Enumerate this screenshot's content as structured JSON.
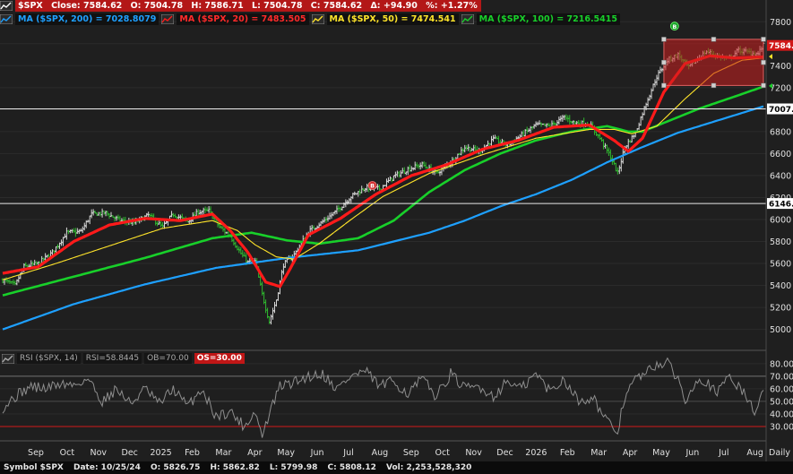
{
  "header": {
    "quote": {
      "symbol": "$SPX",
      "close": "Close: 7584.62",
      "open": "O: 7504.78",
      "high": "H: 7586.71",
      "low": "L: 7504.78",
      "close2": "C: 7584.62",
      "change": "Δ: +94.90",
      "pct": "%: +1.27%"
    },
    "ma200": "MA ($SPX, 200) = 7028.8079",
    "ma20": "MA ($SPX, 20) = 7483.505",
    "ma50": "MA ($SPX, 50) = 7474.541",
    "ma100": "MA ($SPX, 100) = 7216.5415"
  },
  "rsi_header": {
    "name": "RSI ($SPX, 14)",
    "value": "RSI=58.8445",
    "ob": "OB=70.00",
    "os": "OS=30.00"
  },
  "status_bar": {
    "symbol": "Symbol $SPX",
    "date": "Date: 10/25/24",
    "open": "O: 5826.75",
    "high": "H: 5862.82",
    "low": "L: 5799.98",
    "close": "C: 5808.12",
    "vol": "Vol: 2,253,528,320"
  },
  "colors": {
    "ma200": "#1ea0ff",
    "ma20": "#ff1a1a",
    "ma50": "#ffe42a",
    "ma100": "#18d02a",
    "price": "#dcdcdc",
    "rsi": "#8e8e8e",
    "ob": "#6f6f6f",
    "os": "#d01818",
    "box": "#cc1f1f"
  },
  "chart_data": [
    {
      "type": "line",
      "title": "",
      "x_ticks": [
        "Sep",
        "Oct",
        "Nov",
        "Dec",
        "2025",
        "Feb",
        "Mar",
        "Apr",
        "May",
        "Jun",
        "Jul",
        "Aug",
        "Sep",
        "Oct",
        "Nov",
        "Dec",
        "2026",
        "Feb",
        "Mar",
        "Apr",
        "May",
        "Jun",
        "Jul",
        "Aug"
      ],
      "period": "Daily",
      "y_ticks": [
        5000,
        5200,
        5400,
        5600,
        5800,
        6000,
        6200,
        6400,
        6600,
        6800,
        7000,
        7200,
        7400,
        7600,
        7800
      ],
      "ylim": [
        4850,
        7900
      ],
      "price_anchors": [
        [
          0,
          5450
        ],
        [
          7,
          5400
        ],
        [
          12,
          5570
        ],
        [
          20,
          5600
        ],
        [
          28,
          5700
        ],
        [
          36,
          5880
        ],
        [
          44,
          5890
        ],
        [
          50,
          6050
        ],
        [
          58,
          6060
        ],
        [
          66,
          5990
        ],
        [
          74,
          5970
        ],
        [
          82,
          6040
        ],
        [
          90,
          5930
        ],
        [
          96,
          6050
        ],
        [
          104,
          5980
        ],
        [
          110,
          6070
        ],
        [
          116,
          6080
        ],
        [
          122,
          5930
        ],
        [
          128,
          5850
        ],
        [
          134,
          5690
        ],
        [
          138,
          5610
        ],
        [
          142,
          5620
        ],
        [
          146,
          5320
        ],
        [
          150,
          5070
        ],
        [
          154,
          5270
        ],
        [
          158,
          5590
        ],
        [
          164,
          5680
        ],
        [
          172,
          5890
        ],
        [
          180,
          5980
        ],
        [
          188,
          6080
        ],
        [
          196,
          6210
        ],
        [
          204,
          6290
        ],
        [
          212,
          6280
        ],
        [
          220,
          6390
        ],
        [
          228,
          6460
        ],
        [
          236,
          6500
        ],
        [
          244,
          6420
        ],
        [
          252,
          6520
        ],
        [
          260,
          6660
        ],
        [
          268,
          6620
        ],
        [
          276,
          6730
        ],
        [
          284,
          6680
        ],
        [
          292,
          6770
        ],
        [
          300,
          6860
        ],
        [
          308,
          6850
        ],
        [
          316,
          6930
        ],
        [
          322,
          6880
        ],
        [
          330,
          6870
        ],
        [
          336,
          6740
        ],
        [
          342,
          6570
        ],
        [
          346,
          6420
        ],
        [
          350,
          6660
        ],
        [
          356,
          6790
        ],
        [
          362,
          7060
        ],
        [
          368,
          7300
        ],
        [
          374,
          7450
        ],
        [
          380,
          7500
        ],
        [
          386,
          7380
        ],
        [
          390,
          7450
        ],
        [
          396,
          7530
        ],
        [
          402,
          7490
        ],
        [
          408,
          7460
        ],
        [
          414,
          7540
        ],
        [
          420,
          7520
        ],
        [
          425,
          7510
        ],
        [
          428,
          7585
        ]
      ],
      "series": [
        {
          "name": "MA ($SPX, 20)",
          "anchors": [
            [
              0,
              5510
            ],
            [
              20,
              5570
            ],
            [
              40,
              5800
            ],
            [
              60,
              5950
            ],
            [
              80,
              6010
            ],
            [
              100,
              5990
            ],
            [
              118,
              6050
            ],
            [
              128,
              5900
            ],
            [
              138,
              5700
            ],
            [
              148,
              5430
            ],
            [
              156,
              5390
            ],
            [
              162,
              5560
            ],
            [
              172,
              5860
            ],
            [
              190,
              6010
            ],
            [
              210,
              6230
            ],
            [
              230,
              6400
            ],
            [
              250,
              6500
            ],
            [
              270,
              6640
            ],
            [
              290,
              6720
            ],
            [
              310,
              6840
            ],
            [
              330,
              6860
            ],
            [
              344,
              6720
            ],
            [
              352,
              6620
            ],
            [
              360,
              6740
            ],
            [
              372,
              7160
            ],
            [
              384,
              7420
            ],
            [
              398,
              7490
            ],
            [
              412,
              7470
            ],
            [
              428,
              7480
            ]
          ]
        },
        {
          "name": "MA ($SPX, 50)",
          "anchors": [
            [
              0,
              5450
            ],
            [
              30,
              5600
            ],
            [
              60,
              5760
            ],
            [
              90,
              5920
            ],
            [
              118,
              5990
            ],
            [
              132,
              5900
            ],
            [
              142,
              5770
            ],
            [
              154,
              5660
            ],
            [
              164,
              5640
            ],
            [
              178,
              5780
            ],
            [
              196,
              6000
            ],
            [
              214,
              6210
            ],
            [
              240,
              6420
            ],
            [
              270,
              6590
            ],
            [
              300,
              6740
            ],
            [
              330,
              6820
            ],
            [
              344,
              6820
            ],
            [
              354,
              6780
            ],
            [
              368,
              6850
            ],
            [
              384,
              7100
            ],
            [
              400,
              7330
            ],
            [
              416,
              7450
            ],
            [
              428,
              7470
            ]
          ]
        },
        {
          "name": "MA ($SPX, 100)",
          "anchors": [
            [
              0,
              5310
            ],
            [
              40,
              5480
            ],
            [
              80,
              5650
            ],
            [
              118,
              5830
            ],
            [
              140,
              5880
            ],
            [
              160,
              5810
            ],
            [
              178,
              5780
            ],
            [
              200,
              5830
            ],
            [
              220,
              5990
            ],
            [
              240,
              6250
            ],
            [
              260,
              6450
            ],
            [
              280,
              6600
            ],
            [
              300,
              6720
            ],
            [
              320,
              6800
            ],
            [
              340,
              6850
            ],
            [
              352,
              6800
            ],
            [
              360,
              6800
            ],
            [
              372,
              6880
            ],
            [
              392,
              7010
            ],
            [
              412,
              7120
            ],
            [
              428,
              7210
            ]
          ]
        },
        {
          "name": "MA ($SPX, 200)",
          "anchors": [
            [
              0,
              5000
            ],
            [
              40,
              5230
            ],
            [
              80,
              5410
            ],
            [
              120,
              5560
            ],
            [
              160,
              5650
            ],
            [
              200,
              5720
            ],
            [
              220,
              5800
            ],
            [
              240,
              5880
            ],
            [
              260,
              5990
            ],
            [
              280,
              6120
            ],
            [
              300,
              6230
            ],
            [
              320,
              6360
            ],
            [
              340,
              6520
            ],
            [
              360,
              6660
            ],
            [
              380,
              6790
            ],
            [
              400,
              6890
            ],
            [
              428,
              7030
            ]
          ]
        }
      ],
      "horizontal_lines": [
        7007,
        6146
      ],
      "level_labels": [
        "7007.",
        "6146."
      ],
      "price_label": "7584.",
      "highlight_box": {
        "x": [
          372,
          428
        ],
        "y": [
          7220,
          7640
        ]
      },
      "markers": [
        "B",
        "B"
      ]
    },
    {
      "type": "line",
      "title": "",
      "name": "RSI ($SPX, 14)",
      "y_ticks": [
        30,
        40,
        50,
        60,
        70,
        80
      ],
      "ylim": [
        20,
        87
      ],
      "overbought": 70,
      "oversold": 30,
      "last_value": 58.8445,
      "anchors": [
        [
          0,
          45
        ],
        [
          8,
          55
        ],
        [
          16,
          62
        ],
        [
          24,
          60
        ],
        [
          32,
          64
        ],
        [
          40,
          63
        ],
        [
          48,
          68
        ],
        [
          56,
          50
        ],
        [
          64,
          60
        ],
        [
          72,
          48
        ],
        [
          80,
          60
        ],
        [
          88,
          48
        ],
        [
          96,
          60
        ],
        [
          104,
          46
        ],
        [
          112,
          60
        ],
        [
          120,
          38
        ],
        [
          128,
          42
        ],
        [
          136,
          30
        ],
        [
          142,
          42
        ],
        [
          146,
          22
        ],
        [
          150,
          40
        ],
        [
          156,
          62
        ],
        [
          164,
          65
        ],
        [
          172,
          70
        ],
        [
          180,
          72
        ],
        [
          188,
          60
        ],
        [
          196,
          70
        ],
        [
          204,
          74
        ],
        [
          212,
          62
        ],
        [
          220,
          66
        ],
        [
          228,
          56
        ],
        [
          236,
          68
        ],
        [
          244,
          54
        ],
        [
          252,
          72
        ],
        [
          260,
          60
        ],
        [
          268,
          62
        ],
        [
          276,
          54
        ],
        [
          284,
          66
        ],
        [
          292,
          60
        ],
        [
          300,
          72
        ],
        [
          308,
          58
        ],
        [
          316,
          68
        ],
        [
          324,
          50
        ],
        [
          332,
          54
        ],
        [
          338,
          38
        ],
        [
          342,
          30
        ],
        [
          346,
          26
        ],
        [
          350,
          54
        ],
        [
          356,
          68
        ],
        [
          362,
          72
        ],
        [
          368,
          80
        ],
        [
          374,
          80
        ],
        [
          380,
          68
        ],
        [
          384,
          50
        ],
        [
          390,
          68
        ],
        [
          396,
          66
        ],
        [
          402,
          55
        ],
        [
          408,
          72
        ],
        [
          414,
          62
        ],
        [
          420,
          50
        ],
        [
          424,
          40
        ],
        [
          428,
          59
        ]
      ]
    }
  ]
}
